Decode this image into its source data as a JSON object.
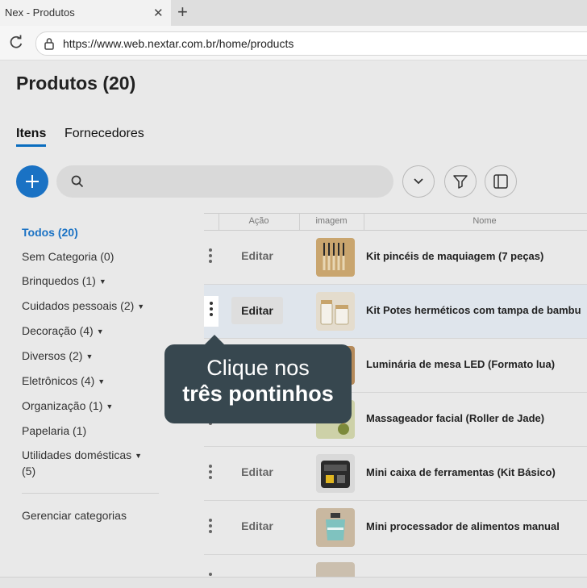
{
  "browser": {
    "tab_title": "Nex - Produtos",
    "url": "https://www.web.nextar.com.br/home/products"
  },
  "header": {
    "title": "Produtos (20)"
  },
  "tabs": [
    {
      "label": "Itens",
      "active": true
    },
    {
      "label": "Fornecedores",
      "active": false
    }
  ],
  "search": {
    "placeholder": ""
  },
  "sidebar": {
    "categories": [
      {
        "label": "Todos (20)",
        "active": true
      },
      {
        "label": "Sem Categoria (0)"
      },
      {
        "label": "Brinquedos (1)",
        "has_caret": true
      },
      {
        "label": "Cuidados pessoais (2)",
        "has_caret": true
      },
      {
        "label": "Decoração (4)",
        "has_caret": true
      },
      {
        "label": "Diversos (2)",
        "has_caret": true
      },
      {
        "label": "Eletrônicos (4)",
        "has_caret": true
      },
      {
        "label": "Organização (1)",
        "has_caret": true
      },
      {
        "label": "Papelaria (1)"
      },
      {
        "label": "Utilidades domésticas",
        "label2": "(5)",
        "has_caret": true
      }
    ],
    "manage_label": "Gerenciar categorias"
  },
  "table": {
    "columns": [
      "Ação",
      "imagem",
      "Nome"
    ],
    "edit_label": "Editar",
    "rows": [
      {
        "name": "Kit pincéis de maquiagem (7 peças)",
        "thumb_color": "#c9a56e"
      },
      {
        "name": "Kit Potes herméticos com tampa de bambu",
        "thumb_color": "#d8cbb4",
        "highlighted": true
      },
      {
        "name": "Luminária de mesa LED (Formato lua)",
        "thumb_color": "#b58a5a"
      },
      {
        "name": "Massageador facial (Roller de Jade)",
        "thumb_color": "#a8b27a"
      },
      {
        "name": "Mini caixa de ferramentas (Kit Básico)",
        "thumb_color": "#3a3a3a"
      },
      {
        "name": "Mini processador de alimentos manual",
        "thumb_color": "#7fc2bf"
      }
    ]
  },
  "tooltip": {
    "line1": "Clique nos",
    "line2": "três pontinhos"
  },
  "colors": {
    "accent": "#1a72c4",
    "tooltip_bg": "#37474f"
  }
}
